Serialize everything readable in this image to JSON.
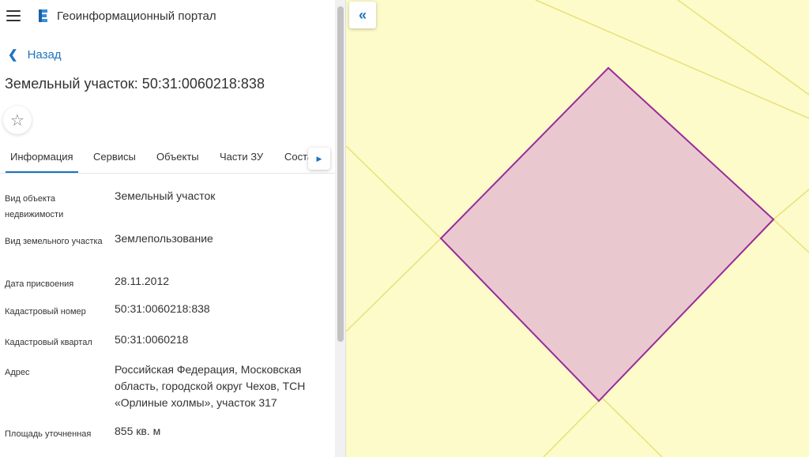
{
  "header": {
    "menu_icon": "hamburger-menu-icon",
    "logo_icon": "portal-logo-icon",
    "title": "Геоинформационный портал"
  },
  "nav": {
    "back_label": "Назад",
    "back_icon": "chevron-left-icon"
  },
  "page": {
    "title": "Земельный участок: 50:31:0060218:838",
    "favorite_icon": "star-outline-icon"
  },
  "tabs": [
    {
      "label": "Информация",
      "active": true
    },
    {
      "label": "Сервисы",
      "active": false
    },
    {
      "label": "Объекты",
      "active": false
    },
    {
      "label": "Части ЗУ",
      "active": false
    },
    {
      "label": "Соста",
      "active": false
    }
  ],
  "tabs_scroll_icon": "caret-right-icon",
  "properties": [
    {
      "label": "Вид объекта недвижимости",
      "value": "Земельный участок"
    },
    {
      "label": "Вид земельного участка",
      "value": "Землепользование"
    },
    {
      "label": "Дата присвоения",
      "value": "28.11.2012"
    },
    {
      "label": "Кадастровый номер",
      "value": "50:31:0060218:838"
    },
    {
      "label": "Кадастровый квартал",
      "value": "50:31:0060218"
    },
    {
      "label": "Адрес",
      "value": "Российская Федерация, Московская область, городской округ Чехов, ТСН «Орлиные холмы», участок 317"
    },
    {
      "label": "Площадь уточненная",
      "value": "855 кв. м"
    }
  ],
  "map": {
    "collapse_icon": "double-chevron-left-icon",
    "colors": {
      "background": "#fdfbc9",
      "boundary_lines": "#e9e07a",
      "parcel_fill": "#e9c9cf",
      "parcel_stroke": "#9b2a9b"
    }
  },
  "colors": {
    "accent": "#1e73be"
  }
}
